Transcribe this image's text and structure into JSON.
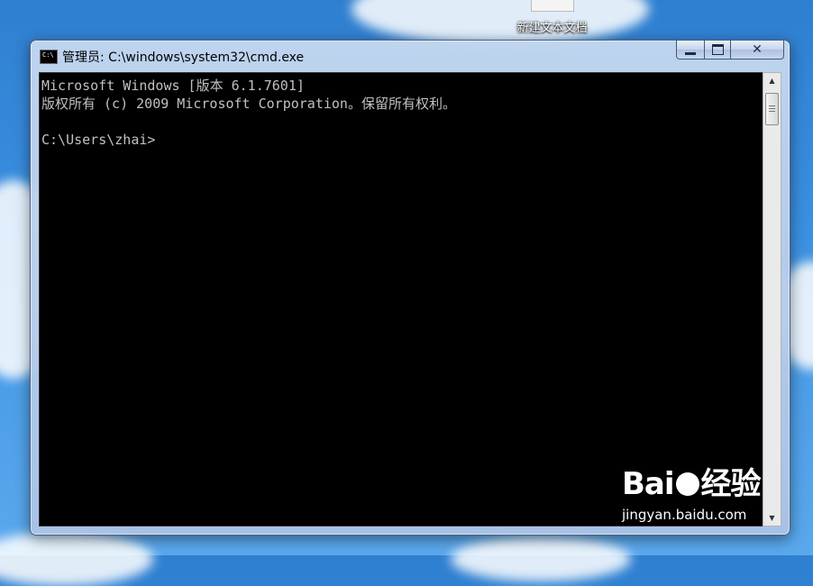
{
  "desktop": {
    "icon_label": "新建文本文档"
  },
  "window": {
    "title": "管理员: C:\\windows\\system32\\cmd.exe",
    "icon_glyph": "C:\\",
    "controls": {
      "minimize": "minimize-icon",
      "maximize": "maximize-icon",
      "close": "✕"
    }
  },
  "console": {
    "lines": [
      "Microsoft Windows [版本 6.1.7601]",
      "版权所有 (c) 2009 Microsoft Corporation。保留所有权利。",
      "",
      "C:\\Users\\zhai>"
    ]
  },
  "scrollbar": {
    "up_arrow": "▲",
    "down_arrow": "▼"
  },
  "watermark": {
    "logo_left": "Bai",
    "logo_right": "经验",
    "url": "jingyan.baidu.com"
  }
}
